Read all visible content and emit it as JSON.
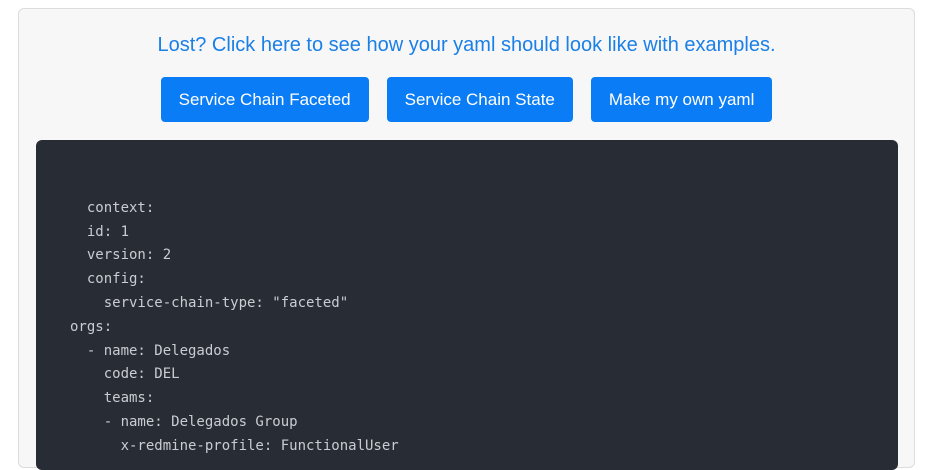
{
  "help": {
    "link_text": "Lost? Click here to see how your yaml should look like with examples."
  },
  "buttons": {
    "faceted": "Service Chain Faceted",
    "state": "Service Chain State",
    "own": "Make my own yaml"
  },
  "code": {
    "yaml": "\n  context:\n  id: 1\n  version: 2\n  config:\n    service-chain-type: \"faceted\"\norgs:\n  - name: Delegados\n    code: DEL\n    teams:\n    - name: Delegados Group\n      x-redmine-profile: FunctionalUser"
  }
}
